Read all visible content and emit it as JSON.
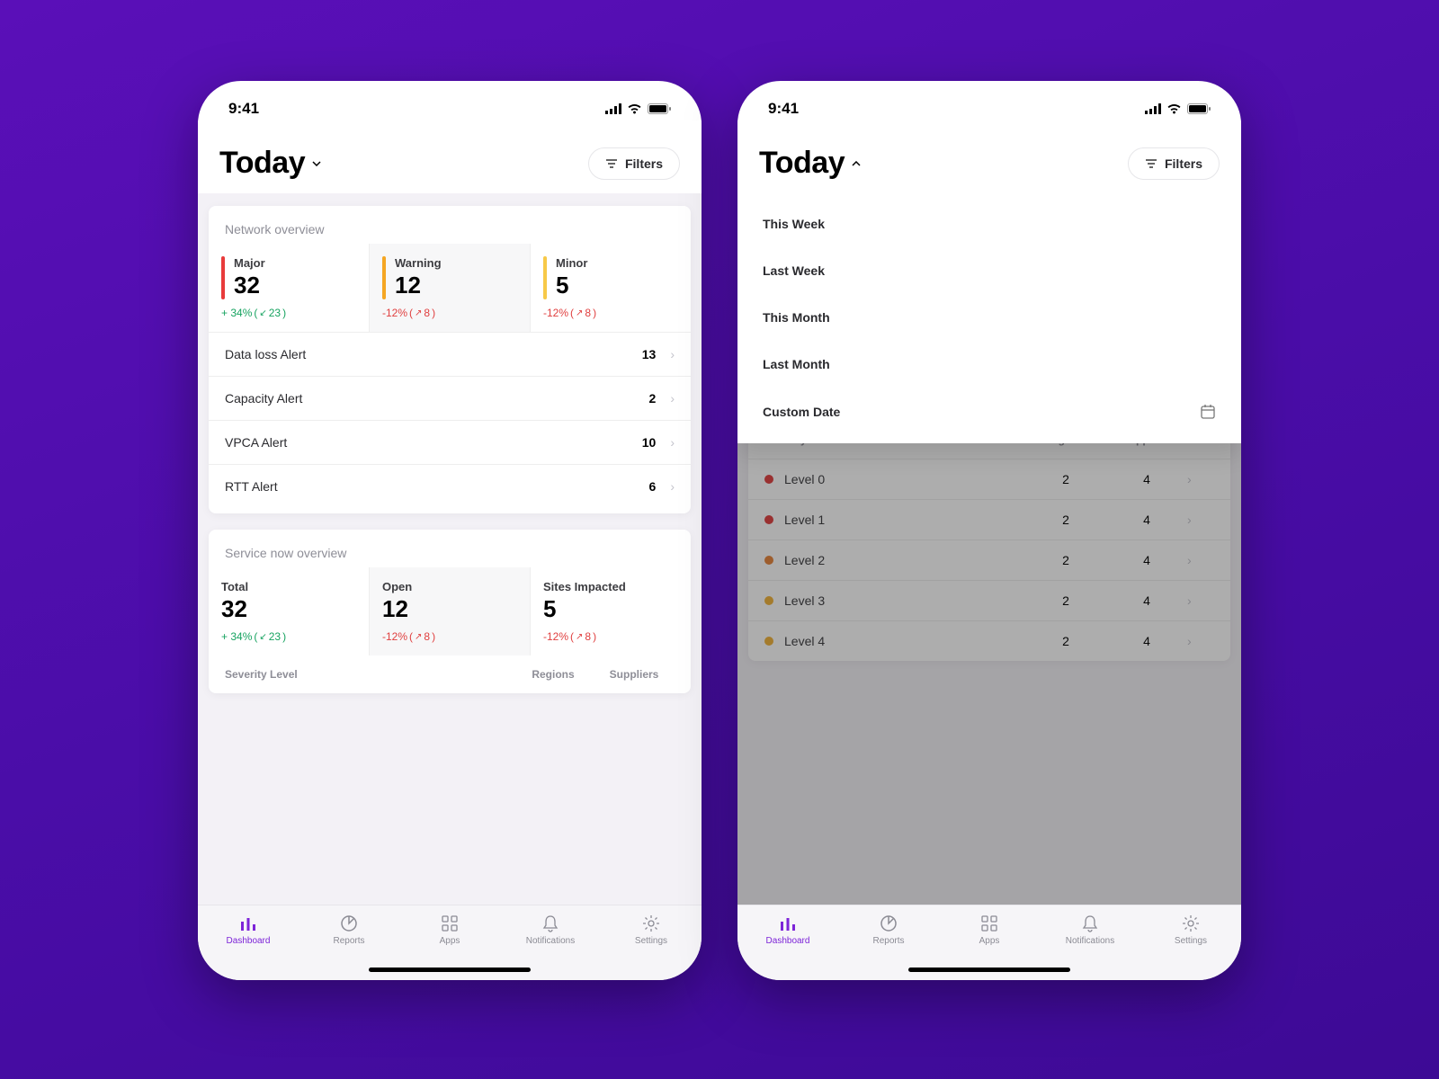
{
  "status": {
    "time": "9:41"
  },
  "header": {
    "title": "Today",
    "filters_label": "Filters"
  },
  "dropdown": {
    "items": [
      {
        "label": "This Week"
      },
      {
        "label": "Last Week"
      },
      {
        "label": "This Month"
      },
      {
        "label": "Last Month"
      },
      {
        "label": "Custom Date",
        "icon": "calendar"
      }
    ]
  },
  "network_overview": {
    "title": "Network overview",
    "stats": [
      {
        "label": "Major",
        "value": "32",
        "color": "#e83b3b",
        "delta_text": "+ 34%",
        "sub_text": "23",
        "direction": "up"
      },
      {
        "label": "Warning",
        "value": "12",
        "color": "#f5a623",
        "delta_text": "-12%",
        "sub_text": "8",
        "direction": "down",
        "highlight": true
      },
      {
        "label": "Minor",
        "value": "5",
        "color": "#f7c948",
        "delta_text": "-12%",
        "sub_text": "8",
        "direction": "down"
      }
    ],
    "alerts": [
      {
        "label": "Data loss Alert",
        "value": "13"
      },
      {
        "label": "Capacity Alert",
        "value": "2"
      },
      {
        "label": "VPCA Alert",
        "value": "10"
      },
      {
        "label": "RTT Alert",
        "value": "6"
      }
    ]
  },
  "service_now": {
    "title": "Service now overview",
    "stats": [
      {
        "label": "Total",
        "value": "32",
        "delta_text": "+ 34%",
        "sub_text": "23",
        "direction": "up"
      },
      {
        "label": "Open",
        "value": "12",
        "delta_text": "-12%",
        "sub_text": "8",
        "direction": "down",
        "highlight": true
      },
      {
        "label": "Sites Impacted",
        "value": "5",
        "delta_text": "-12%",
        "sub_text": "8",
        "direction": "down"
      }
    ],
    "table": {
      "columns": {
        "severity": "Severity Level",
        "regions": "Regions",
        "suppliers": "Suppliers"
      },
      "rows": [
        {
          "level": "Level 0",
          "color": "#e03f3f",
          "regions": "2",
          "suppliers": "4"
        },
        {
          "level": "Level 1",
          "color": "#e03f3f",
          "regions": "2",
          "suppliers": "4"
        },
        {
          "level": "Level 2",
          "color": "#e6843b",
          "regions": "2",
          "suppliers": "4"
        },
        {
          "level": "Level 3",
          "color": "#f2b33a",
          "regions": "2",
          "suppliers": "4"
        },
        {
          "level": "Level 4",
          "color": "#f2b33a",
          "regions": "2",
          "suppliers": "4"
        }
      ]
    }
  },
  "tabs": [
    {
      "label": "Dashboard",
      "icon": "bars",
      "active": true
    },
    {
      "label": "Reports",
      "icon": "pie"
    },
    {
      "label": "Apps",
      "icon": "grid"
    },
    {
      "label": "Notifications",
      "icon": "bell"
    },
    {
      "label": "Settings",
      "icon": "gear"
    }
  ]
}
